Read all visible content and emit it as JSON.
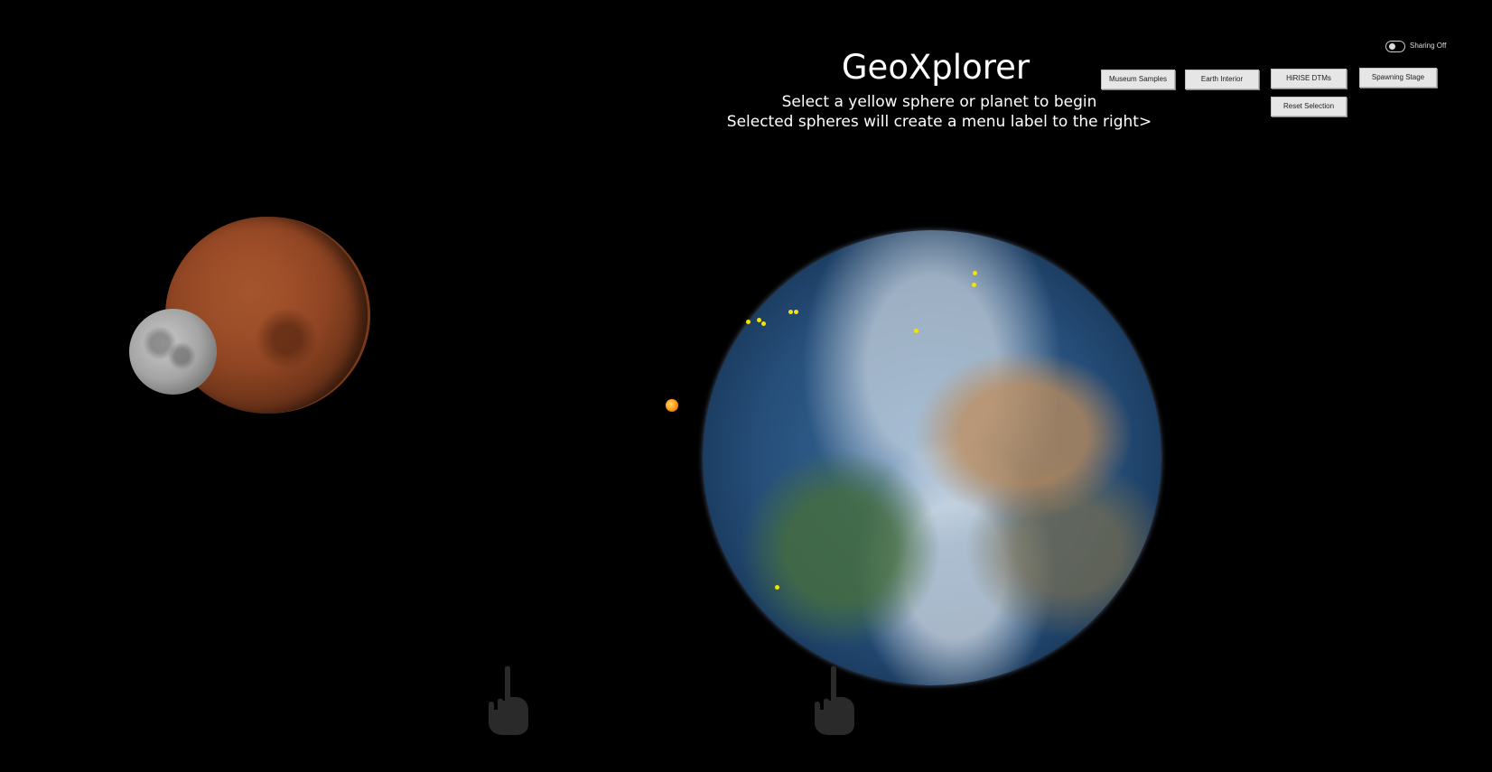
{
  "header": {
    "title": "GeoXplorer",
    "subtitle_line1": "Select a yellow sphere or planet to begin",
    "subtitle_line2": "Selected spheres will create a menu label to the right>"
  },
  "menu": {
    "buttons": [
      "Museum Samples",
      "Earth Interior",
      "HiRISE DTMs",
      "Spawning Stage"
    ],
    "reset": "Reset Selection"
  },
  "sharing": {
    "label": "Sharing Off",
    "state": "off"
  },
  "scene": {
    "bodies": [
      "mars",
      "moon",
      "sun",
      "earth"
    ],
    "marker_color": "#f5e400"
  }
}
